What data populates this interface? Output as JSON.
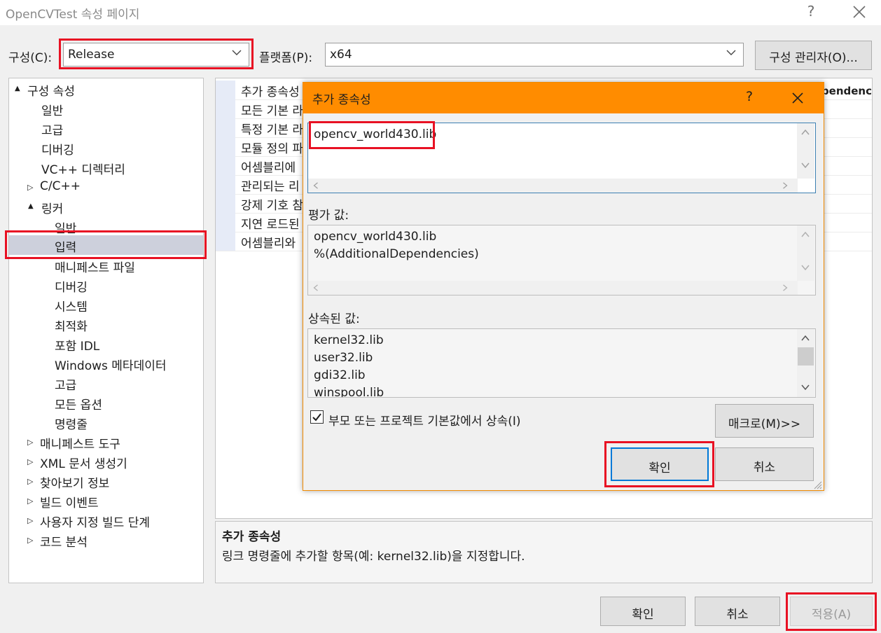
{
  "window": {
    "title": "OpenCVTest 속성 페이지",
    "help": "?"
  },
  "config": {
    "configuration_label": "구성(C):",
    "configuration_value": "Release",
    "platform_label": "플랫폼(P):",
    "platform_value": "x64",
    "manager_button": "구성 관리자(O)..."
  },
  "tree": {
    "items": [
      {
        "label": "구성 속성",
        "expander": "▲"
      },
      {
        "label": "일반",
        "expander": ""
      },
      {
        "label": "고급",
        "expander": ""
      },
      {
        "label": "디버깅",
        "expander": ""
      },
      {
        "label": "VC++ 디렉터리",
        "expander": ""
      },
      {
        "label": "C/C++",
        "expander": "▷"
      },
      {
        "label": "링커",
        "expander": "▲"
      },
      {
        "label": "일반",
        "expander": ""
      },
      {
        "label": "입력",
        "expander": ""
      },
      {
        "label": "매니페스트 파일",
        "expander": ""
      },
      {
        "label": "디버깅",
        "expander": ""
      },
      {
        "label": "시스템",
        "expander": ""
      },
      {
        "label": "최적화",
        "expander": ""
      },
      {
        "label": "포함 IDL",
        "expander": ""
      },
      {
        "label": "Windows 메타데이터",
        "expander": ""
      },
      {
        "label": "고급",
        "expander": ""
      },
      {
        "label": "모든 옵션",
        "expander": ""
      },
      {
        "label": "명령줄",
        "expander": ""
      },
      {
        "label": "매니페스트 도구",
        "expander": "▷"
      },
      {
        "label": "XML 문서 생성기",
        "expander": "▷"
      },
      {
        "label": "찾아보기 정보",
        "expander": "▷"
      },
      {
        "label": "빌드 이벤트",
        "expander": "▷"
      },
      {
        "label": "사용자 지정 빌드 단계",
        "expander": "▷"
      },
      {
        "label": "코드 분석",
        "expander": "▷"
      }
    ]
  },
  "grid": {
    "rows": [
      "추가 종속성",
      "모든 기본 라",
      "특정 기본 라",
      "모듈 정의 파",
      "어셈블리에",
      "관리되는 리",
      "강제 기호 참",
      "지연 로드된",
      "어셈블리와"
    ],
    "first_row_value": "ependenc"
  },
  "description": {
    "title": "추가 종속성",
    "text": "링크 명령줄에 추가할 항목(예: kernel32.lib)을 지정합니다."
  },
  "dialog": {
    "title": "추가 종속성",
    "help": "?",
    "input_value": "opencv_world430.lib",
    "evaluated_label": "평가 값:",
    "evaluated_lines": [
      "opencv_world430.lib",
      "%(AdditionalDependencies)"
    ],
    "inherited_label": "상속된 값:",
    "inherited_lines": [
      "kernel32.lib",
      "user32.lib",
      "gdi32.lib",
      "winspool.lib"
    ],
    "inherit_checkbox_label": "부모 또는 프로젝트 기본값에서 상속(I)",
    "inherit_checked": true,
    "macro_button": "매크로(M)>>",
    "ok_button": "확인",
    "cancel_button": "취소"
  },
  "footer": {
    "ok": "확인",
    "cancel": "취소",
    "apply": "적용(A)"
  },
  "colors": {
    "highlight_red": "#e81123",
    "dialog_title_orange": "#ff8c00",
    "selection": "#cdd0dc"
  }
}
